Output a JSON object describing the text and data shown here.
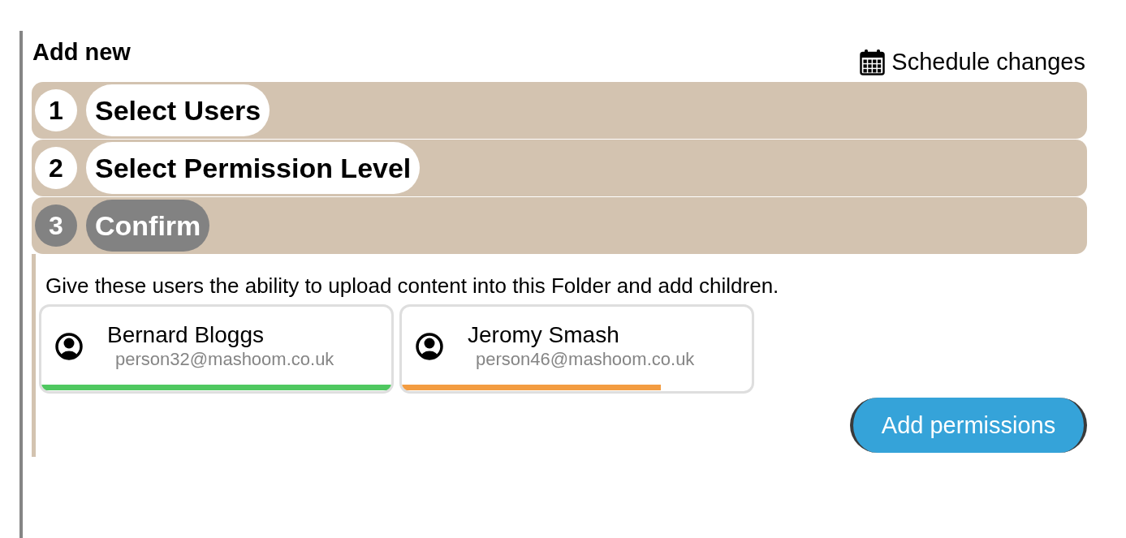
{
  "header": {
    "title": "Add new",
    "schedule_link": "Schedule changes"
  },
  "steps": [
    {
      "number": "1",
      "label": "Select Users",
      "selected": false
    },
    {
      "number": "2",
      "label": "Select Permission Level",
      "selected": false
    },
    {
      "number": "3",
      "label": "Confirm",
      "selected": true
    }
  ],
  "confirm": {
    "description": "Give these users the ability to upload content into this Folder and add children.",
    "users": [
      {
        "name": "Bernard Bloggs",
        "email": "person32@mashoom.co.uk",
        "level": 1,
        "color": "#4fc860"
      },
      {
        "name": "Jeromy Smash",
        "email": "person46@mashoom.co.uk",
        "level": 0.74,
        "color": "#f39c41"
      }
    ],
    "button": "Add permissions"
  }
}
